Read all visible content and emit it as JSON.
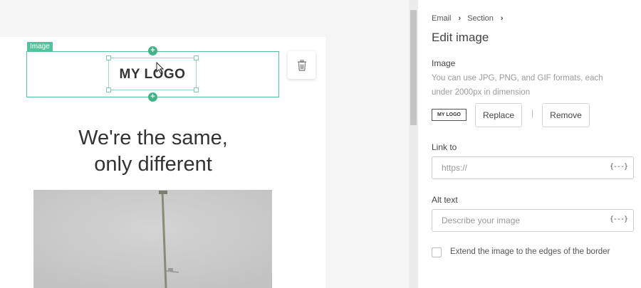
{
  "canvas": {
    "image_tag": "Image",
    "logo_text": "MY LOGO",
    "headline_line1": "We're the same,",
    "headline_line2": "only different"
  },
  "panel": {
    "breadcrumb": [
      "Email",
      "Section"
    ],
    "title": "Edit image",
    "image_section": {
      "label": "Image",
      "help": "You can use JPG, PNG, and GIF formats, each under 2000px in dimension",
      "thumb_text": "MY LOGO",
      "replace_label": "Replace",
      "separator": "|",
      "remove_label": "Remove"
    },
    "link": {
      "label": "Link to",
      "placeholder": "https://",
      "var_icon": "{---}"
    },
    "alt": {
      "label": "Alt text",
      "placeholder": "Describe your image",
      "var_icon": "{---}"
    },
    "extend_label": "Extend the image to the edges of the border"
  },
  "colors": {
    "accent": "#52c49c",
    "handle": "#3fb586"
  }
}
